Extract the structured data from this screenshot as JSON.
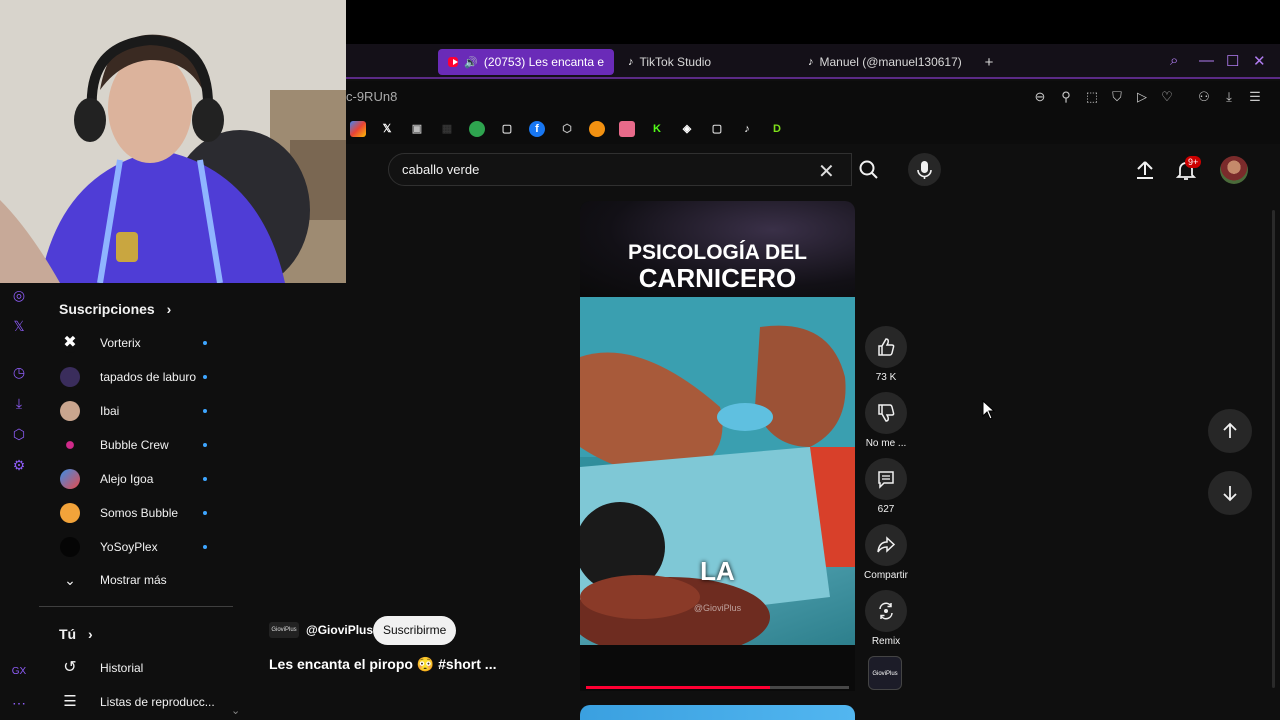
{
  "browser": {
    "tabs": [
      {
        "label": "(20753) Les encanta e",
        "active": true,
        "icon": "youtube-icon"
      },
      {
        "label": "TikTok Studio",
        "active": false,
        "icon": "tiktok-icon"
      },
      {
        "label": "Manuel (@manuel130617)",
        "active": false,
        "icon": "tiktok-icon"
      }
    ],
    "new_tab": "+",
    "url_fragment": "c-9RUn8",
    "bookmark_letters": {
      "k": "K",
      "d": "D"
    }
  },
  "header": {
    "search_value": "caballo verde",
    "notifications_badge": "9+"
  },
  "sidebar": {
    "subscriptions_heading": "Suscripciones",
    "subscriptions": [
      {
        "name": "Vorterix"
      },
      {
        "name": "tapados de laburo"
      },
      {
        "name": "Ibai"
      },
      {
        "name": "Bubble Crew"
      },
      {
        "name": "Alejo Igoa"
      },
      {
        "name": "Somos Bubble"
      },
      {
        "name": "YoSoyPlex"
      }
    ],
    "show_more": "Mostrar más",
    "you_heading": "Tú",
    "you_items": [
      {
        "label": "Historial"
      },
      {
        "label": "Listas de reproducc..."
      }
    ]
  },
  "short": {
    "title_line1": "PSICOLOGÍA DEL",
    "title_line2": "CARNICERO",
    "caption": "LA",
    "watermark": "@GioviPlus",
    "progress": 0.7,
    "channel": "@GioviPlus",
    "channel_avatar_text": "GioviPlus",
    "subscribe_label": "Suscribirme",
    "video_title": "Les encanta el piropo 😳     #short ..."
  },
  "actions": {
    "likes": "73 K",
    "dislike_label": "No me ...",
    "comments": "627",
    "share_label": "Compartir",
    "remix_label": "Remix",
    "remix_thumb_text": "GioviPlus"
  },
  "colors": {
    "accent": "#6a2bb8",
    "youtube_red": "#ff0033",
    "subscribe_bg": "#f1f1f1",
    "new_dot": "#3ea6ff"
  }
}
